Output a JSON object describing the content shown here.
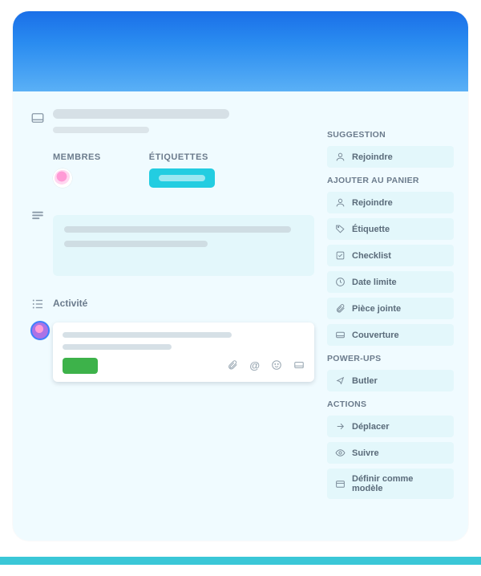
{
  "main": {
    "members_heading": "MEMBRES",
    "etiquettes_heading": "ÉTIQUETTES",
    "activity_heading": "Activité"
  },
  "sidebar": {
    "suggestion_heading": "SUGGESTION",
    "suggestion_items": [
      "Rejoindre"
    ],
    "add_heading": "AJOUTER AU PANIER",
    "add_items": [
      "Rejoindre",
      "Étiquette",
      "Checklist",
      "Date limite",
      "Pièce jointe",
      "Couverture"
    ],
    "powerups_heading": "POWER-UPS",
    "powerups_items": [
      "Butler"
    ],
    "actions_heading": "ACTIONS",
    "actions_items": [
      "Déplacer",
      "Suivre",
      "Définir comme modèle"
    ]
  }
}
